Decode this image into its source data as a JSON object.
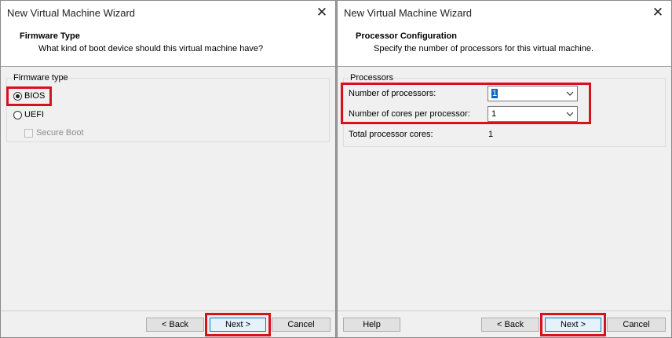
{
  "left": {
    "window_title": "New Virtual Machine Wizard",
    "close_glyph": "✕",
    "header_title": "Firmware Type",
    "header_subtitle": "What kind of boot device should this virtual machine have?",
    "group_label": "Firmware type",
    "options": [
      {
        "label": "BIOS",
        "checked": true
      },
      {
        "label": "UEFI",
        "checked": false
      }
    ],
    "secure_boot_label": "Secure Boot",
    "buttons": {
      "back": "< Back",
      "next": "Next >",
      "cancel": "Cancel"
    }
  },
  "right": {
    "window_title": "New Virtual Machine Wizard",
    "close_glyph": "✕",
    "header_title": "Processor Configuration",
    "header_subtitle": "Specify the number of processors for this virtual machine.",
    "group_label": "Processors",
    "num_processors_label": "Number of processors:",
    "num_processors_value": "1",
    "cores_per_processor_label": "Number of cores per processor:",
    "cores_per_processor_value": "1",
    "total_cores_label": "Total processor cores:",
    "total_cores_value": "1",
    "buttons": {
      "help": "Help",
      "back": "< Back",
      "next": "Next >",
      "cancel": "Cancel"
    }
  },
  "colors": {
    "highlight": "#d7121f",
    "selection": "#0b63c4",
    "default_button_border": "#0078d7"
  },
  "icons": [
    "close-icon",
    "chevron-down-icon"
  ]
}
